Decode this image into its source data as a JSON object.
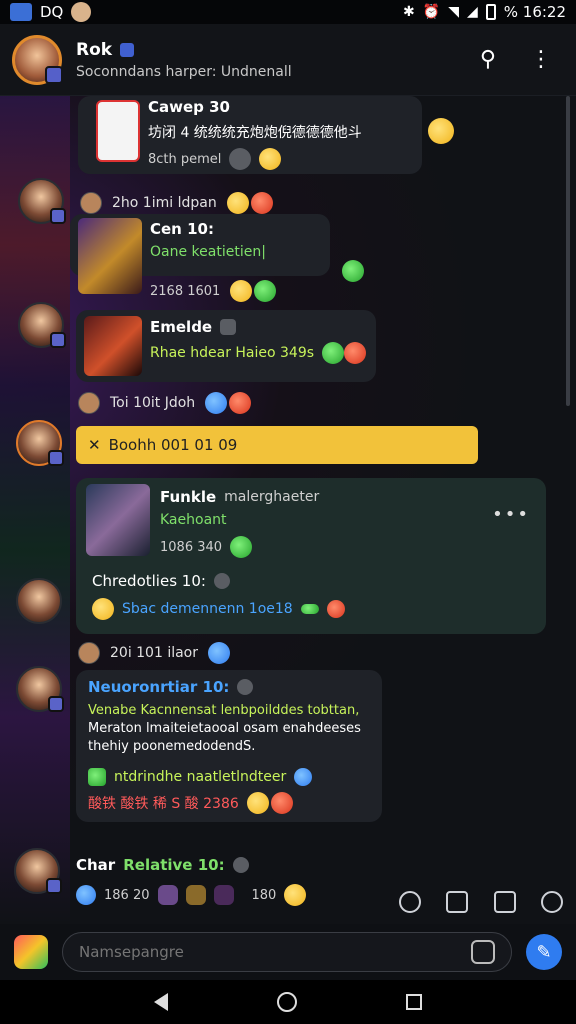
{
  "status": {
    "left_text": "DQ",
    "time": "% 16:22"
  },
  "header": {
    "title": "Rok",
    "subtitle": "Soconndans harper: Undnenall"
  },
  "messages": {
    "m1": {
      "title": "Cawep 30",
      "line": "坊闭 4 统统统充炮炮倪德德德他斗",
      "meta": "8cth pemel"
    },
    "m2": {
      "meta": "2ho  1imi ldpan",
      "title": "Cen 10:",
      "line": "Oane keatietien|",
      "stamp": "2168  1601"
    },
    "m3": {
      "title": "Emelde",
      "line": "Rhae hdear  Haieo 349s"
    },
    "m4": {
      "meta": "Toi  10it  Jdoh"
    },
    "banner": {
      "text": "Boohh 001 01 09"
    },
    "m5": {
      "title": "Funkle",
      "title_suffix": "malerghaeter",
      "line": "Kaehoant",
      "stamp": "1086  340"
    },
    "m6": {
      "title": "Chredotlies 10:",
      "line": "Sbac demennenn 1oe18"
    },
    "m7": {
      "meta": "20i  101  ilaor"
    },
    "m8": {
      "title": "Neuoronrtiar 10:",
      "line1": "Venabe Kacnnensat lenbpoilddes tobttan,",
      "line2": "Meraton lmaiteietaooal osam enahdeeses",
      "line3": "thehiy poonemedodendS.",
      "line4": "ntdrindhe naatletlndteer",
      "line5": "酸铁 酸铁  稀 S 酸  2386"
    },
    "m9": {
      "title_prefix": "Char",
      "title_highlight": "Relative 10:",
      "stamp1": "186  20",
      "stamp2": "180"
    }
  },
  "composer": {
    "placeholder": "Namsepangre"
  }
}
